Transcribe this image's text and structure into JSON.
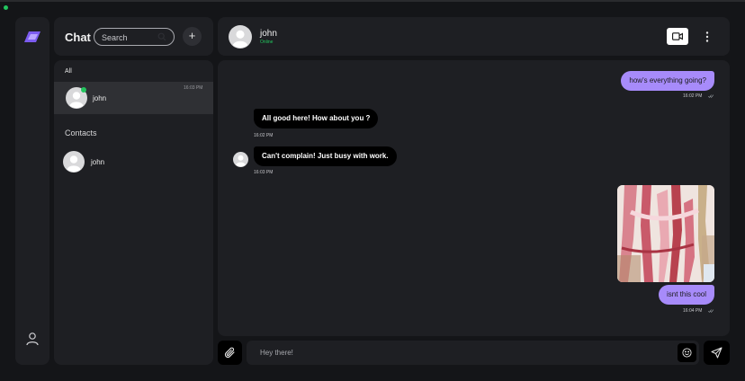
{
  "sidebar": {
    "title": "Chat",
    "search_placeholder": "Search",
    "filter_label": "All",
    "chats": [
      {
        "name": "john",
        "time": "16:03 PM",
        "online": true
      }
    ],
    "contacts_title": "Contacts",
    "contacts": [
      {
        "name": "john"
      }
    ]
  },
  "chat_header": {
    "name": "john",
    "status": "Online"
  },
  "messages": [
    {
      "direction": "out",
      "text": "how's everything going?",
      "time": "16:02 PM"
    },
    {
      "direction": "in",
      "text": "All good here! How about you ?",
      "time": "16:02 PM"
    },
    {
      "direction": "in",
      "text": "Can't complain! Just busy with work.",
      "time": "16:03 PM"
    },
    {
      "direction": "out",
      "type": "image",
      "text": "isnt this cool",
      "time": "16:04 PM"
    }
  ],
  "composer": {
    "placeholder": "Hey there!"
  },
  "colors": {
    "accent": "#a78bfa",
    "online": "#22c55e",
    "panel": "#1e1f23",
    "background": "#141518"
  },
  "icons": [
    "logo-icon",
    "user-icon",
    "search-icon",
    "plus-icon",
    "video-camera-icon",
    "more-vertical-icon",
    "double-check-icon",
    "paperclip-icon",
    "smiley-icon",
    "send-icon",
    "avatar"
  ]
}
